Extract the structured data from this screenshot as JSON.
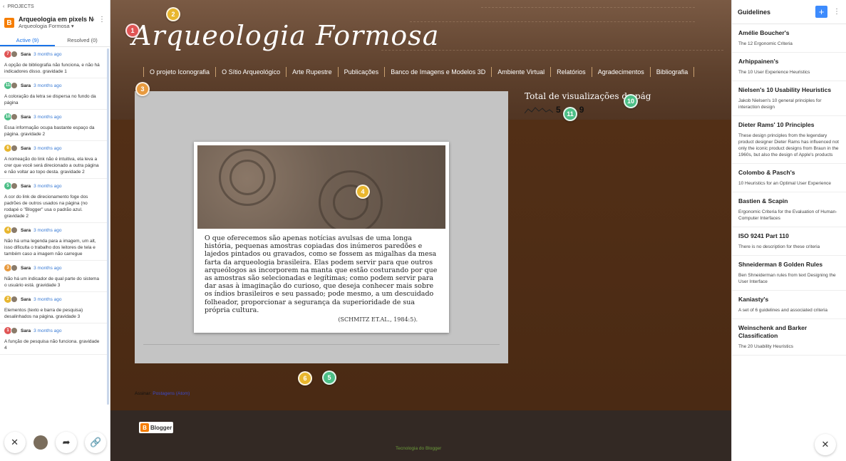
{
  "left": {
    "back_label": "PROJECTS",
    "project_name": "Arqueologia em pixels Nov",
    "project_sub": "Arqueologia Formosa",
    "tabs": [
      "Active (9)",
      "Resolved (0)"
    ],
    "comments": [
      {
        "num": "7",
        "color": "#e05555",
        "user": "Sara",
        "time": "3 months ago",
        "text": "A opção de bibliografia não funciona, e não há indicadores disso. gravidade 1"
      },
      {
        "num": "11",
        "color": "#4cbf87",
        "user": "Sara",
        "time": "3 months ago",
        "text": "A coloração da letra se dispersa no fundo da página"
      },
      {
        "num": "10",
        "color": "#4cbf87",
        "user": "Sara",
        "time": "3 months ago",
        "text": "Essa informação ocupa bastante espaço da página. gravidade 2"
      },
      {
        "num": "6",
        "color": "#e8b62e",
        "user": "Sara",
        "time": "3 months ago",
        "text": "A nomeação do link não é intuitiva, ela leva a crer que você será direcionado a outra página e não voltar ao topo desta. gravidade 2"
      },
      {
        "num": "5",
        "color": "#4cbf87",
        "user": "Sara",
        "time": "3 months ago",
        "text": "A cor do link de direcionamento foge dos padrões de outros usados na página (no rodapé o \"Blogger\" usa o padrão azul. gravidade 2"
      },
      {
        "num": "4",
        "color": "#e8b62e",
        "user": "Sara",
        "time": "3 months ago",
        "text": "Não há uma legenda para a imagem, um alt, isso dificulta o trabalho dos leitores de tela e também caso a imagem não carregue"
      },
      {
        "num": "3",
        "color": "#e89a3e",
        "user": "Sara",
        "time": "3 months ago",
        "text": "Não há um indicador de qual parte do sistema o usuário está. gravidade 3"
      },
      {
        "num": "2",
        "color": "#e8b62e",
        "user": "Sara",
        "time": "3 months ago",
        "text": "Elementos (texto e barra de pesquisa) desalinhados na página. gravidade 3"
      },
      {
        "num": "1",
        "color": "#e05555",
        "user": "Sara",
        "time": "3 months ago",
        "text": "A função de pesquisa não funciona. gravidade 4"
      }
    ]
  },
  "center": {
    "site_title": "Arqueologia Formosa",
    "nav": [
      "O projeto Iconografia",
      "O Sítio Arqueológico",
      "Arte Rupestre",
      "Publicações",
      "Banco de Imagens e Modelos 3D",
      "Ambiente Virtual",
      "Relatórios",
      "Agradecimentos",
      "Bibliografia"
    ],
    "quote": "O que oferecemos são apenas notícias avulsas de uma longa história, pequenas amostras copiadas dos inúmeros paredões e lajedos pintados ou gravados, como se fossem as migalhas da mesa farta da arqueologia brasileira. Elas podem servir para que outros arqueólogos as incorporem na manta que estão costurando por que as amostras são selecionadas e legítimas; como podem servir para dar asas à imaginação do curioso, que deseja conhecer mais sobre os índios brasileiros e seu passado; pode mesmo, a um descuidado folheador, proporcionar a segurança da superioridade de sua própria cultura.",
    "citation": "(SCHMITZ ET.AL., 1984:5).",
    "stats_title": "Total de visualizações de pág",
    "stats_value": "5",
    "stats_value_tail": "9",
    "footer_link_tail": "al",
    "footer_link_head": "n",
    "assinar_label": "Assinar:",
    "assinar_link": "Postagens (Atom)",
    "blogger_badge": "Blogger",
    "tech_label": "Tecnologia do",
    "tech_link": "Blogger"
  },
  "markers": [
    {
      "num": "1",
      "color": "#e05555"
    },
    {
      "num": "2",
      "color": "#e8b62e"
    },
    {
      "num": "3",
      "color": "#e89a3e"
    },
    {
      "num": "4",
      "color": "#e8b62e"
    },
    {
      "num": "5",
      "color": "#4cbf87"
    },
    {
      "num": "6",
      "color": "#e8b62e"
    },
    {
      "num": "10",
      "color": "#4cbf87"
    },
    {
      "num": "11",
      "color": "#4cbf87"
    }
  ],
  "right": {
    "title": "Guidelines",
    "plus": "+",
    "guidelines": [
      {
        "title": "Amélie Boucher's",
        "desc": "The 12 Ergonomic Criteria"
      },
      {
        "title": "Arhippainen's",
        "desc": "The 10 User Experience Heuristics"
      },
      {
        "title": "Nielsen's 10 Usability Heuristics",
        "desc": "Jakob Nielsen's 10 general principles for interaction design"
      },
      {
        "title": "Dieter Rams' 10 Principles",
        "desc": "These design principles from the legendary product designer Dieter Rams has influenced not only the iconic product designs from Braun in the 1960s, but also the design of Apple's products"
      },
      {
        "title": "Colombo & Pasch's",
        "desc": "10 Heuristics for an Optimal User Experience"
      },
      {
        "title": "Bastien & Scapin",
        "desc": "Ergonomic Criteria for the Evaluation of Human-Computer Interfaces"
      },
      {
        "title": "ISO 9241 Part 110",
        "desc": "There is no description for these criteria"
      },
      {
        "title": "Shneiderman 8 Golden Rules",
        "desc": "Ben Shneiderman rules from text Designing the User Interface"
      },
      {
        "title": "Kaniasty's",
        "desc": "A set of 6 guidelines and associated criteria"
      },
      {
        "title": "Weinschenk and Barker Classification",
        "desc": "The 20 Usability Heuristics"
      }
    ]
  }
}
